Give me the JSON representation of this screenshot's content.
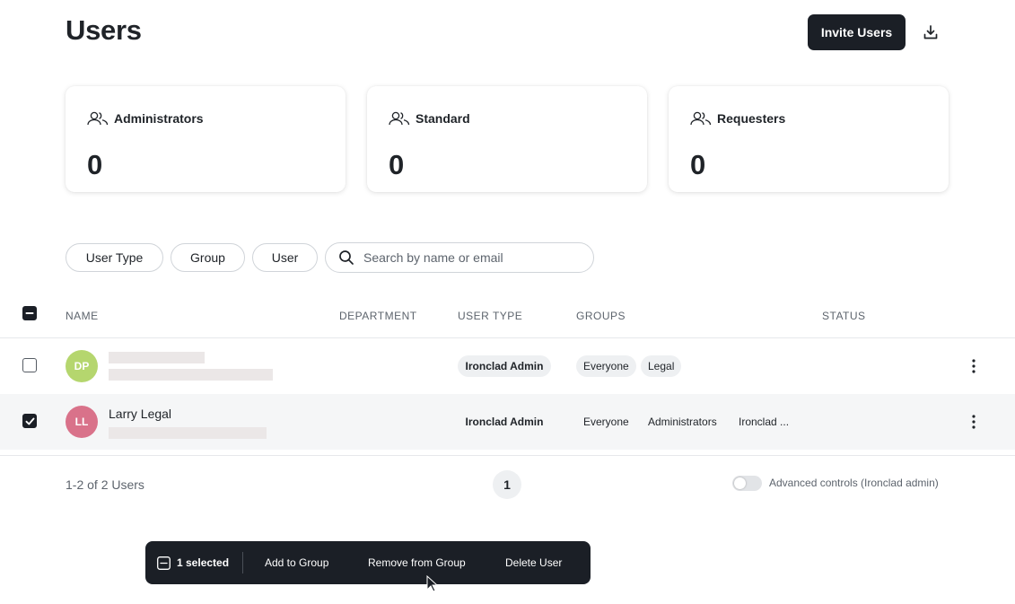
{
  "header": {
    "title": "Users",
    "invite_label": "Invite Users",
    "download_icon": "download-icon"
  },
  "cards": [
    {
      "label": "Administrators",
      "value": "0",
      "icon": "users-icon"
    },
    {
      "label": "Standard",
      "value": "0",
      "icon": "users-icon"
    },
    {
      "label": "Requesters",
      "value": "0",
      "icon": "users-icon"
    }
  ],
  "filters": {
    "items": [
      "User Type",
      "Group",
      "User"
    ],
    "search_placeholder": "Search by name or email"
  },
  "table": {
    "columns": [
      "NAME",
      "DEPARTMENT",
      "USER TYPE",
      "GROUPS",
      "STATUS"
    ],
    "rows": [
      {
        "initials": "DP",
        "avatar_color": "#b5d66e",
        "name": "",
        "user_type": "Ironclad Admin",
        "groups": [
          "Everyone",
          "Legal"
        ],
        "selected": false
      },
      {
        "initials": "LL",
        "avatar_color": "#d9728a",
        "name": "Larry Legal",
        "user_type": "Ironclad Admin",
        "groups": [
          "Everyone",
          "Administrators",
          "Ironclad ..."
        ],
        "selected": true
      }
    ]
  },
  "footer": {
    "count_text": "1-2 of 2 Users",
    "page": "1",
    "toggle_label": "Advanced controls (Ironclad admin)",
    "toggle_on": false
  },
  "action_bar": {
    "selected_text": "1 selected",
    "add_to_group": "Add to Group",
    "remove_from_group": "Remove from Group",
    "delete_user": "Delete User"
  },
  "colors": {
    "primary_dark": "#1b1f26",
    "row_selected_bg": "#f5f6f7",
    "redacted": "#ebe7e7"
  }
}
